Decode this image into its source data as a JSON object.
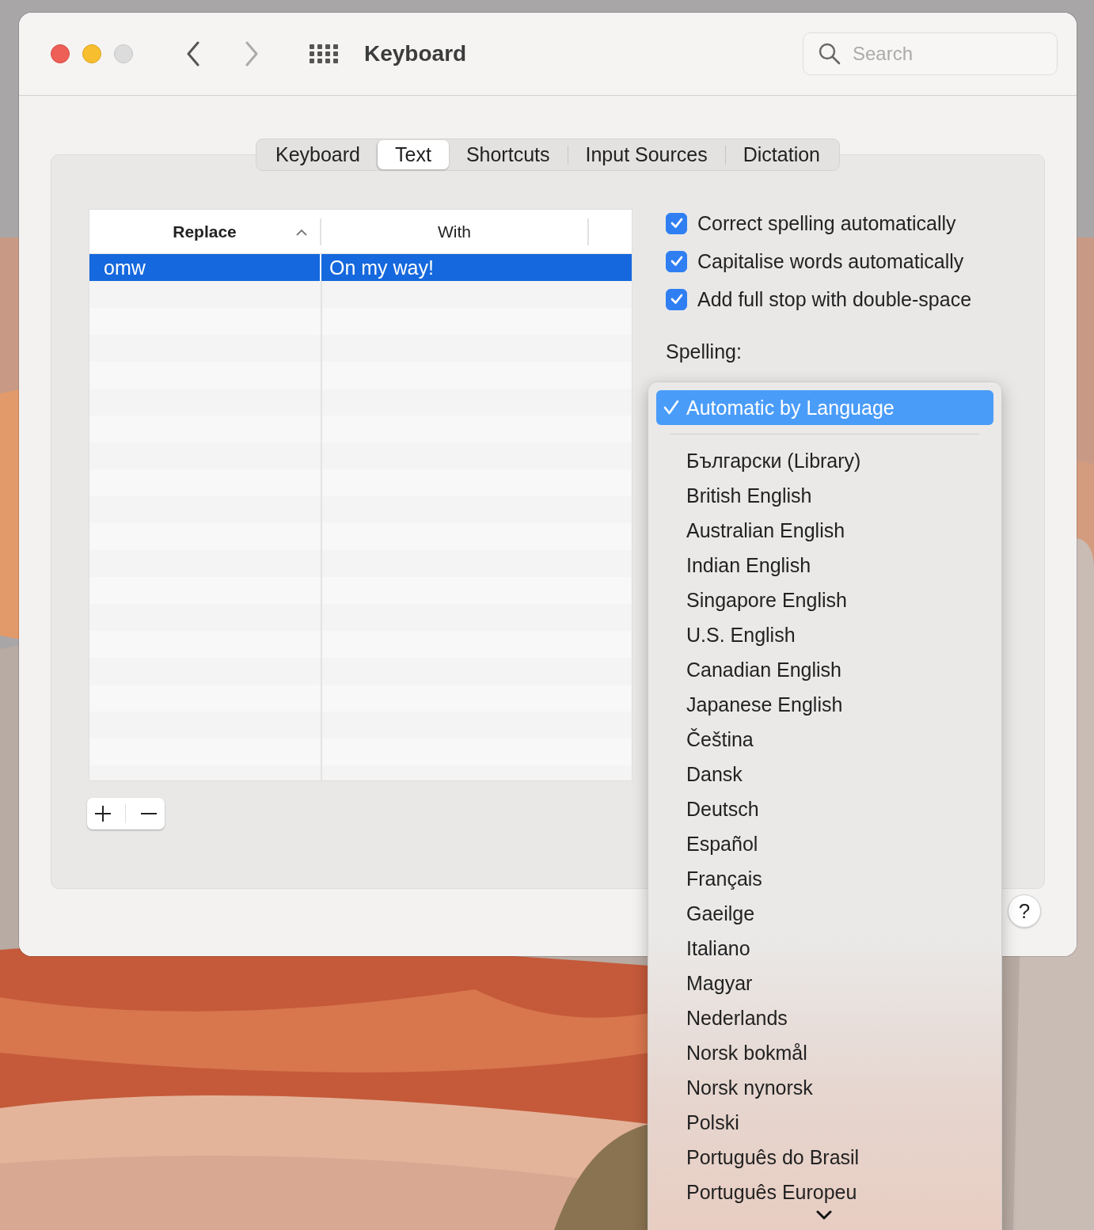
{
  "window": {
    "title": "Keyboard",
    "search": {
      "placeholder": "Search"
    }
  },
  "tabs": [
    {
      "label": "Keyboard",
      "selected": false
    },
    {
      "label": "Text",
      "selected": true
    },
    {
      "label": "Shortcuts",
      "selected": false
    },
    {
      "label": "Input Sources",
      "selected": false
    },
    {
      "label": "Dictation",
      "selected": false
    }
  ],
  "replacements": {
    "columns": [
      {
        "label": "Replace",
        "sorted": true
      },
      {
        "label": "With",
        "sorted": false
      }
    ],
    "rows": [
      {
        "replace": "omw",
        "with": "On my way!",
        "selected": true
      }
    ]
  },
  "options": [
    {
      "label": "Correct spelling automatically",
      "checked": true
    },
    {
      "label": "Capitalise words automatically",
      "checked": true
    },
    {
      "label": "Add full stop with double-space",
      "checked": true
    }
  ],
  "spelling": {
    "label": "Spelling:"
  },
  "help_button": "?",
  "spelling_menu": {
    "items": [
      {
        "kind": "option",
        "label": "Automatic by Language",
        "selected": true
      },
      {
        "kind": "separator"
      },
      {
        "kind": "option",
        "label": "Български (Library)",
        "selected": false
      },
      {
        "kind": "option",
        "label": "British English",
        "selected": false
      },
      {
        "kind": "option",
        "label": "Australian English",
        "selected": false
      },
      {
        "kind": "option",
        "label": "Indian English",
        "selected": false
      },
      {
        "kind": "option",
        "label": "Singapore English",
        "selected": false
      },
      {
        "kind": "option",
        "label": "U.S. English",
        "selected": false
      },
      {
        "kind": "option",
        "label": "Canadian English",
        "selected": false
      },
      {
        "kind": "option",
        "label": "Japanese English",
        "selected": false
      },
      {
        "kind": "option",
        "label": "Čeština",
        "selected": false
      },
      {
        "kind": "option",
        "label": "Dansk",
        "selected": false
      },
      {
        "kind": "option",
        "label": "Deutsch",
        "selected": false
      },
      {
        "kind": "option",
        "label": "Español",
        "selected": false
      },
      {
        "kind": "option",
        "label": "Français",
        "selected": false
      },
      {
        "kind": "option",
        "label": "Gaeilge",
        "selected": false
      },
      {
        "kind": "option",
        "label": "Italiano",
        "selected": false
      },
      {
        "kind": "option",
        "label": "Magyar",
        "selected": false
      },
      {
        "kind": "option",
        "label": "Nederlands",
        "selected": false
      },
      {
        "kind": "option",
        "label": "Norsk bokmål",
        "selected": false
      },
      {
        "kind": "option",
        "label": "Norsk nynorsk",
        "selected": false
      },
      {
        "kind": "option",
        "label": "Polski",
        "selected": false
      },
      {
        "kind": "option",
        "label": "Português do Brasil",
        "selected": false
      },
      {
        "kind": "option",
        "label": "Português Europeu",
        "selected": false
      }
    ]
  }
}
